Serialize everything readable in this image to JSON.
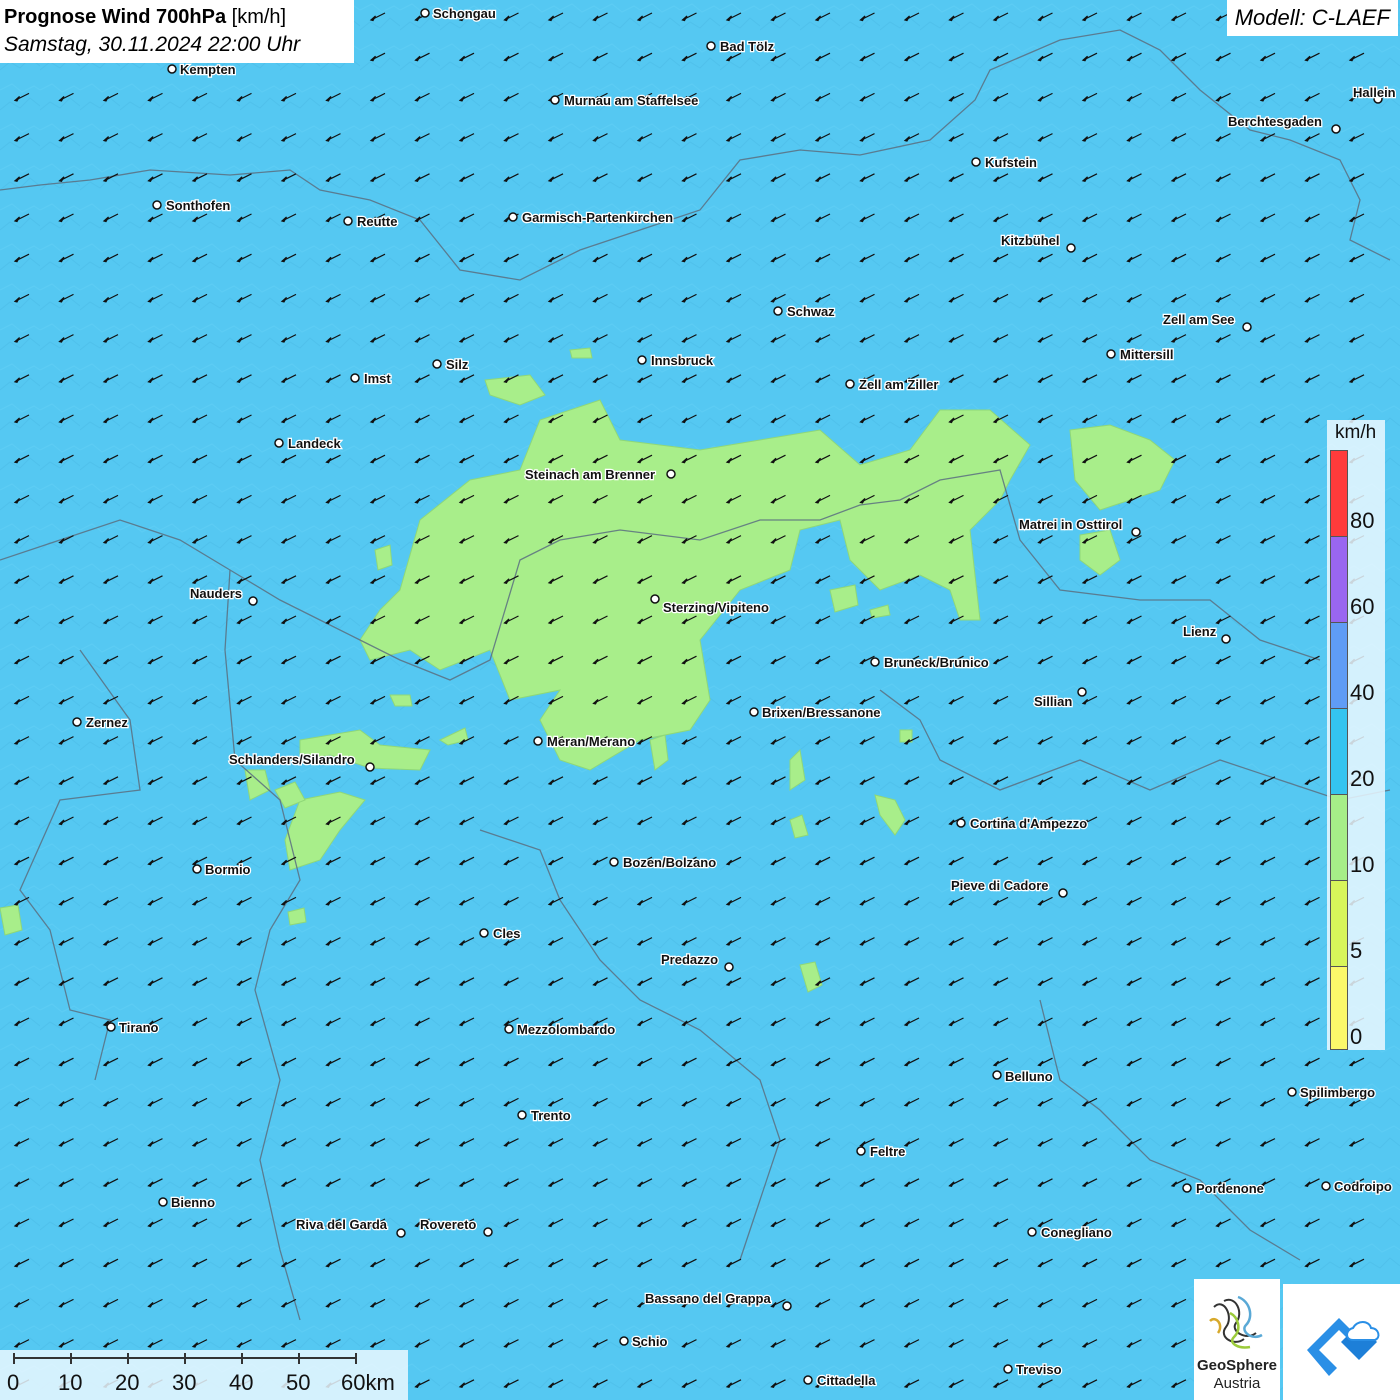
{
  "title": {
    "main": "Prognose Wind 700hPa",
    "unit": "[km/h]",
    "datetime": "Samstag, 30.11.2024 22:00 Uhr"
  },
  "model": "Modell: C-LAEF",
  "map": {
    "background_color": "#55c8f2",
    "calm_area_color": "#a8ee8a",
    "arrow_direction": "toward south-west (wind from north-east)",
    "cities": [
      {
        "name": "Schongau"
      },
      {
        "name": "Bad Tölz"
      },
      {
        "name": "Kempten"
      },
      {
        "name": "Murnau am Staffelsee"
      },
      {
        "name": "Hallein"
      },
      {
        "name": "Berchtesgaden"
      },
      {
        "name": "Kufstein"
      },
      {
        "name": "Sonthofen"
      },
      {
        "name": "Reutte"
      },
      {
        "name": "Garmisch-Partenkirchen"
      },
      {
        "name": "Kitzbühel"
      },
      {
        "name": "Schwaz"
      },
      {
        "name": "Zell am See"
      },
      {
        "name": "Innsbruck"
      },
      {
        "name": "Mittersill"
      },
      {
        "name": "Silz"
      },
      {
        "name": "Imst"
      },
      {
        "name": "Zell am Ziller"
      },
      {
        "name": "Landeck"
      },
      {
        "name": "Steinach am Brenner"
      },
      {
        "name": "Matrei in Osttirol"
      },
      {
        "name": "Nauders"
      },
      {
        "name": "Sterzing/Vipiteno"
      },
      {
        "name": "Lienz"
      },
      {
        "name": "Bruneck/Brunico"
      },
      {
        "name": "Sillian"
      },
      {
        "name": "Brixen/Bressanone"
      },
      {
        "name": "Zernez"
      },
      {
        "name": "Meran/Merano"
      },
      {
        "name": "Schlanders/Silandro"
      },
      {
        "name": "Cortina d'Ampezzo"
      },
      {
        "name": "Bozen/Bolzano"
      },
      {
        "name": "Bormio"
      },
      {
        "name": "Pieve di Cadore"
      },
      {
        "name": "Cles"
      },
      {
        "name": "Predazzo"
      },
      {
        "name": "Tirano"
      },
      {
        "name": "Mezzolombardo"
      },
      {
        "name": "Belluno"
      },
      {
        "name": "Spilimbergo"
      },
      {
        "name": "Trento"
      },
      {
        "name": "Feltre"
      },
      {
        "name": "Pordenone"
      },
      {
        "name": "Codroipo"
      },
      {
        "name": "Bienno"
      },
      {
        "name": "Riva del Garda"
      },
      {
        "name": "Rovereto"
      },
      {
        "name": "Conegliano"
      },
      {
        "name": "Bassano del Grappa"
      },
      {
        "name": "Schio"
      },
      {
        "name": "Treviso"
      },
      {
        "name": "Cittadella"
      }
    ]
  },
  "legend": {
    "unit": "km/h",
    "ticks": [
      "80",
      "60",
      "40",
      "20",
      "10",
      "5",
      "0"
    ],
    "colors": [
      "#ff3b3b",
      "#9966f0",
      "#5f9cf5",
      "#34c4f0",
      "#a6ee88",
      "#d8f55a",
      "#fbf86a"
    ]
  },
  "scale_bar": {
    "labels": [
      "0",
      "10",
      "20",
      "30",
      "40",
      "50",
      "60km"
    ]
  },
  "logos": {
    "geosphere_line1": "GeoSphere",
    "geosphere_line2": "Austria"
  }
}
